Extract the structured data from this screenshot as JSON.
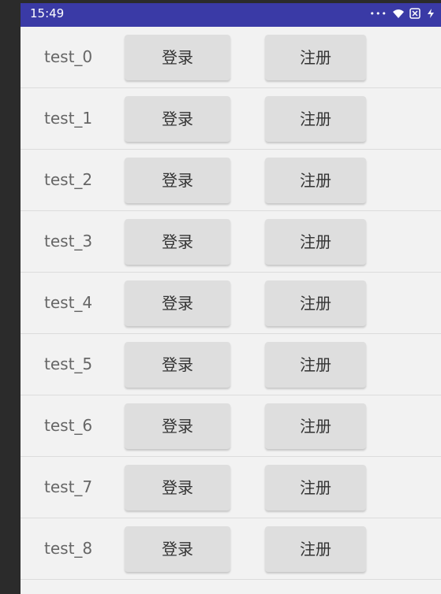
{
  "status_bar": {
    "time": "15:49",
    "icons": [
      "more-dots-icon",
      "wifi-icon",
      "sim-icon",
      "battery-icon"
    ]
  },
  "rows": [
    {
      "label": "test_0",
      "login": "登录",
      "register": "注册"
    },
    {
      "label": "test_1",
      "login": "登录",
      "register": "注册"
    },
    {
      "label": "test_2",
      "login": "登录",
      "register": "注册"
    },
    {
      "label": "test_3",
      "login": "登录",
      "register": "注册"
    },
    {
      "label": "test_4",
      "login": "登录",
      "register": "注册"
    },
    {
      "label": "test_5",
      "login": "登录",
      "register": "注册"
    },
    {
      "label": "test_6",
      "login": "登录",
      "register": "注册"
    },
    {
      "label": "test_7",
      "login": "登录",
      "register": "注册"
    },
    {
      "label": "test_8",
      "login": "登录",
      "register": "注册"
    }
  ],
  "colors": {
    "status_bar": "#3a3aa6",
    "background": "#f2f2f2",
    "button": "#dedede"
  }
}
